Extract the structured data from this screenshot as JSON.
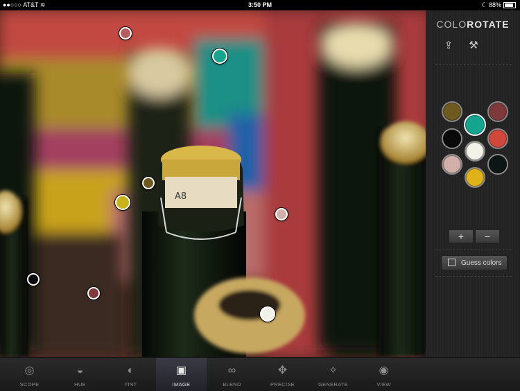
{
  "status_bar": {
    "carrier": "AT&T",
    "time": "3:50 PM",
    "battery": "88%"
  },
  "app": {
    "title_part1": "COLO",
    "title_part2": "ROTATE"
  },
  "sidebar": {
    "share_icon": "share-icon",
    "settings_icon": "wrench-icon",
    "palette": [
      {
        "color": "#6e5a1e"
      },
      {
        "color": "#14a58f",
        "selected": true
      },
      {
        "color": "#7e3a3a"
      },
      {
        "color": "#0a0a0a"
      },
      {
        "color": "#f2f2e8"
      },
      {
        "color": "#d2473c"
      },
      {
        "color": "#d1b0aa"
      },
      {
        "color": "#e0b21a"
      },
      {
        "color": "#0e1516"
      }
    ],
    "add_label": "+",
    "remove_label": "−",
    "guess_label": "Guess colors"
  },
  "pins": [
    {
      "color": "#b55e5e"
    },
    {
      "color": "#14a58f"
    },
    {
      "color": "#6e5a1e"
    },
    {
      "color": "#c9b31a"
    },
    {
      "color": "#d1b0aa"
    },
    {
      "color": "#0a0a0a"
    },
    {
      "color": "#7e3a3a"
    },
    {
      "color": "#f2f2e8"
    }
  ],
  "tabs": [
    {
      "label": "SCOPE",
      "icon": "scope-icon"
    },
    {
      "label": "HUE",
      "icon": "hue-icon"
    },
    {
      "label": "TINT",
      "icon": "tint-icon"
    },
    {
      "label": "IMAGE",
      "icon": "image-icon",
      "active": true
    },
    {
      "label": "BLEND",
      "icon": "blend-icon"
    },
    {
      "label": "PRECISE",
      "icon": "precise-icon"
    },
    {
      "label": "GENERATE",
      "icon": "generate-icon"
    },
    {
      "label": "VIEW",
      "icon": "view-icon"
    }
  ]
}
